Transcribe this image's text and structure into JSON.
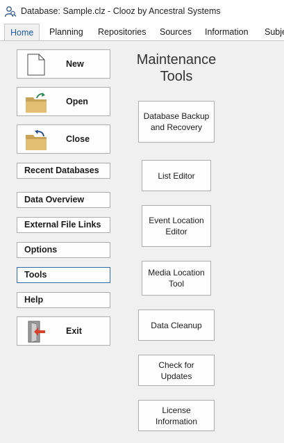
{
  "window": {
    "title": "Database: Sample.clz - Clooz by Ancestral Systems",
    "app_icon": "people-search-icon"
  },
  "tabs": [
    {
      "label": "Home",
      "mnemonic": "H",
      "active": true
    },
    {
      "label": "Planning",
      "mnemonic": "P",
      "active": false
    },
    {
      "label": "Repositories",
      "mnemonic": "R",
      "active": false
    },
    {
      "label": "Sources",
      "mnemonic": "u",
      "active": false
    },
    {
      "label": "Information",
      "mnemonic": "I",
      "active": false
    },
    {
      "label": "Subje",
      "mnemonic": "",
      "active": false
    }
  ],
  "sidebar": {
    "new_label": "New",
    "new_icon": "blank-document-icon",
    "open_label": "Open",
    "open_icon": "open-folder-icon",
    "close_label": "Close",
    "close_icon": "close-folder-icon",
    "recent_label": "Recent Databases",
    "overview_label": "Data Overview",
    "links_label": "External File Links",
    "options_label": "Options",
    "tools_label": "Tools",
    "help_label": "Help",
    "exit_label": "Exit",
    "exit_icon": "exit-door-icon"
  },
  "panel": {
    "title": "Maintenance Tools",
    "tools": [
      {
        "label": "Database Backup and Recovery"
      },
      {
        "label": "List Editor"
      },
      {
        "label": "Event Location Editor"
      },
      {
        "label": "Media Location Tool"
      },
      {
        "label": "Data Cleanup"
      },
      {
        "label": "Check for Updates"
      },
      {
        "label": "License Information"
      }
    ]
  },
  "colors": {
    "accent": "#1f5ea8",
    "folder": "#dcb368",
    "exit_arrow": "#d9412b"
  }
}
